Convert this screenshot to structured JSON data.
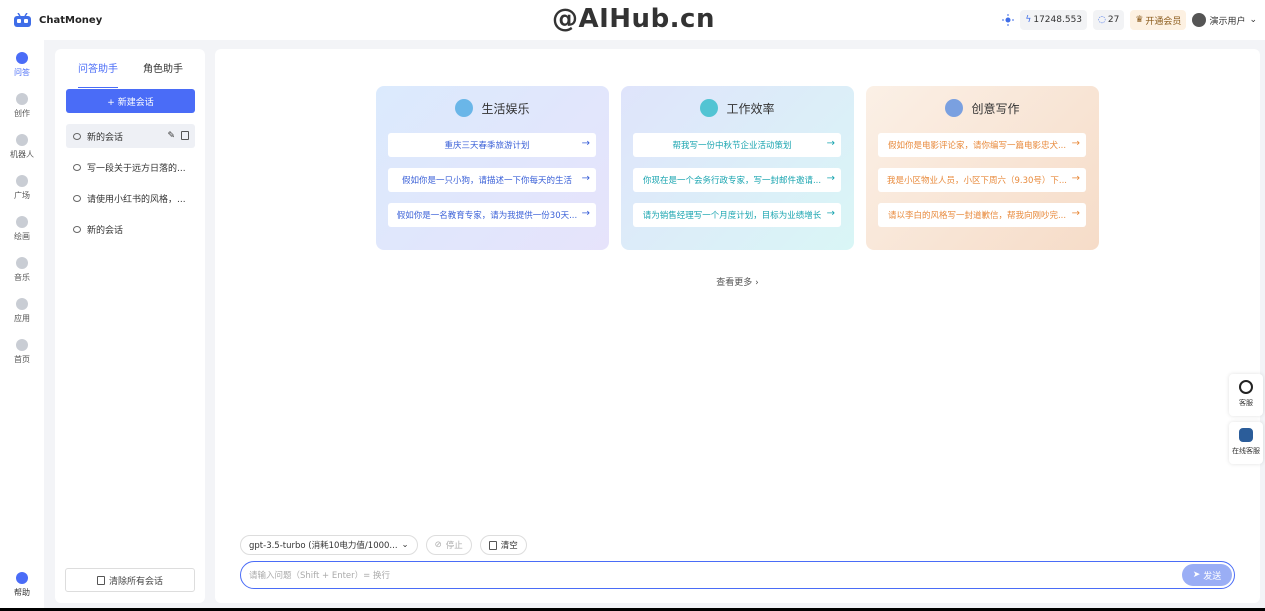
{
  "header": {
    "app_name": "ChatMoney",
    "watermark": "@AIHub.cn",
    "balance": "17248.553",
    "count": "27",
    "vip_label": "开通会员",
    "user_name": "演示用户"
  },
  "leftnav": {
    "items": [
      {
        "label": "问答"
      },
      {
        "label": "创作"
      },
      {
        "label": "机器人"
      },
      {
        "label": "广场"
      },
      {
        "label": "绘画"
      },
      {
        "label": "音乐"
      },
      {
        "label": "应用"
      },
      {
        "label": "首页"
      }
    ],
    "help_label": "帮助"
  },
  "sidebar": {
    "tabs": [
      "问答助手",
      "角色助手"
    ],
    "new_button": "+ 新建会话",
    "conversations": [
      "新的会话",
      "写一段关于远方日落的...",
      "请使用小红书的风格，...",
      "新的会话"
    ],
    "clear_all": "清除所有会话"
  },
  "cards": [
    {
      "title": "生活娱乐",
      "prompts": [
        "重庆三天春季旅游计划",
        "假如你是一只小狗，请描述一下你每天的生活",
        "假如你是一名教育专家，请为我提供一份30天..."
      ]
    },
    {
      "title": "工作效率",
      "prompts": [
        "帮我写一份中秋节企业活动策划",
        "你现在是一个会务行政专家，写一封邮件邀请...",
        "请为销售经理写一个月度计划，目标为业绩增长"
      ]
    },
    {
      "title": "创意写作",
      "prompts": [
        "假如你是电影评论家，请你编写一篇电影忠犬...",
        "我是小区物业人员，小区下周六（9.30号）下...",
        "请以李白的风格写一封道歉信，帮我向刚吵完..."
      ]
    }
  ],
  "see_more": "查看更多 ›",
  "composer": {
    "model": "gpt-3.5-turbo (消耗10电力值/1000...",
    "stop": "停止",
    "clear": "清空",
    "placeholder": "请输入问题（Shift + Enter）= 换行",
    "send": "发送"
  },
  "floating": {
    "service": "客服",
    "online": "在线客服"
  }
}
